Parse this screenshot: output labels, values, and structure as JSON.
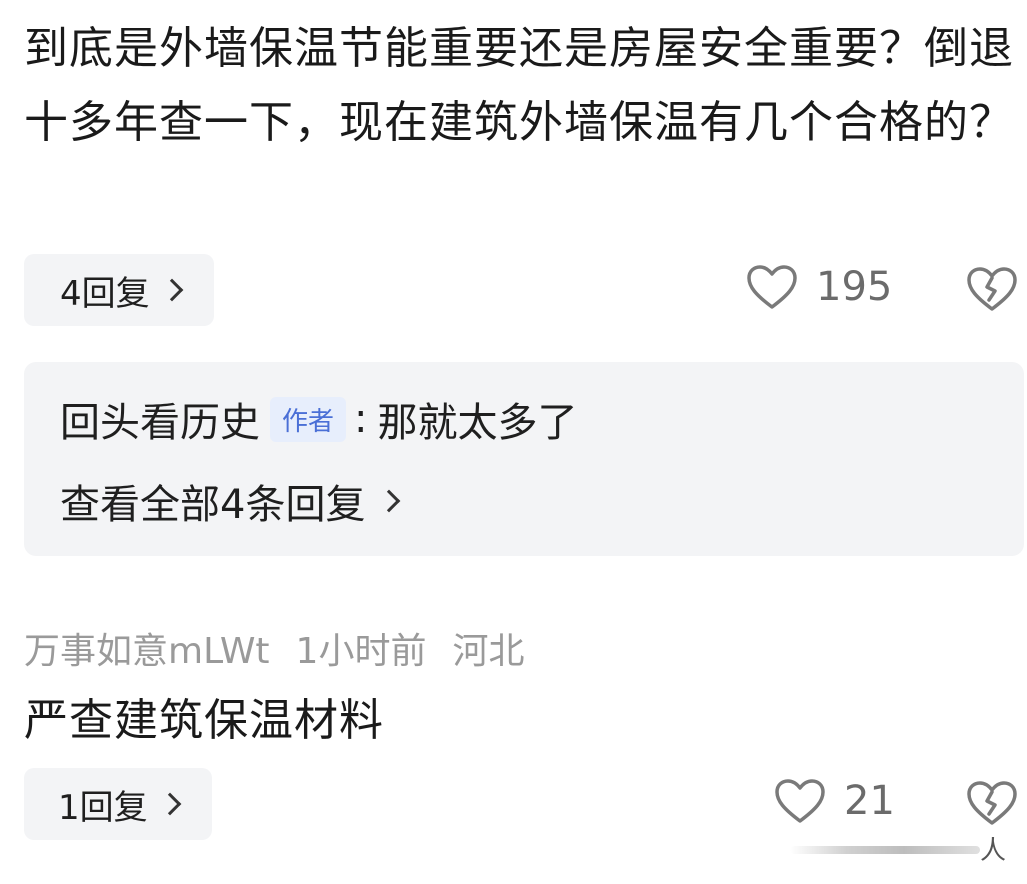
{
  "comment1": {
    "text": "到底是外墙保温节能重要还是房屋安全重要？倒退十多年查一下，现在建筑外墙保温有几个合格的？",
    "replies_label": "4回复",
    "like_count": "195"
  },
  "sub_replies": {
    "author": "回头看历史",
    "badge": "作者",
    "separator": ":",
    "text": "那就太多了",
    "view_all": "查看全部4条回复"
  },
  "comment2": {
    "username": "万事如意mLWt",
    "time": "1小时前",
    "location": "河北",
    "text": "严查建筑保温材料",
    "replies_label": "1回复",
    "like_count": "21"
  },
  "watermark": {
    "glyph": "人"
  },
  "icons": [
    "heart-outline-icon",
    "broken-heart-icon",
    "chevron-right-icon"
  ],
  "colors": {
    "badge_text": "#4a6fd6",
    "badge_bg": "#e7eefc",
    "panel_bg": "#f3f4f6",
    "meta_text": "#9a9a9a",
    "icon_stroke": "#7a7a7a"
  }
}
